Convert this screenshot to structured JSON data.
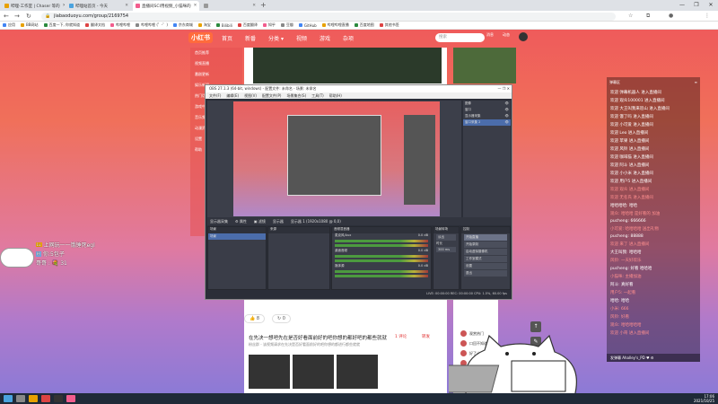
{
  "browser": {
    "tabs": [
      {
        "label": "哔哩-工作室 | Chaser 等的",
        "color": "#e8a100"
      },
      {
        "label": "哔哩站首页 - 今天",
        "color": "#4aa3df"
      },
      {
        "label": "直播间SCI用视频_小猫咪的",
        "color": "#f25d8e",
        "active": true
      },
      {
        "label": "",
        "color": "#999"
      }
    ],
    "new_tab": "+",
    "window_controls": [
      "—",
      "❐",
      "✕"
    ],
    "nav": {
      "back": "←",
      "forward": "→",
      "reload": "↻"
    },
    "url": "jiabaoduoyu.com/group/2169754",
    "lock": "🔒",
    "bookmarks": [
      "应用",
      "BB网站",
      "百度一下, 你就知道",
      "翻译文档",
      "哔哩哔哩",
      "哔哩哔哩 (゜-゜)",
      "京东商城",
      "淘宝",
      "Bilibili",
      "百度翻译",
      "知乎",
      "豆瓣",
      "GitHub",
      "哔哩哔哩直播",
      "百度地图",
      "其他书签"
    ]
  },
  "site": {
    "logo": "小红书",
    "nav": [
      "首页",
      "新番",
      "分类 ▾",
      "视频",
      "游戏",
      "杂项"
    ],
    "search_placeholder": "搜索",
    "top_icons": [
      "消息",
      "动态",
      "投稿"
    ],
    "left_menu": [
      "首页推荐",
      "视频直播",
      "番剧更新",
      "娱乐新闻",
      "热门话题",
      "游戏中心",
      "音乐频道",
      "动漫资讯",
      "设置",
      "帮助"
    ],
    "likes": "8",
    "shares": "0",
    "post_title": "在先决一想吧先在是否好看面前好的吧你想的都好吧的都些就就",
    "post_sub": "粉丝群 - 该视频请求在先决是否好看面前好的吧你想的都进行都些就就",
    "post_meta": [
      "1 评论",
      "转发"
    ],
    "right_cards": [
      "观赏热门",
      "口回不知道",
      "好了十阅读",
      "还差一大",
      "不加不知"
    ],
    "side_buttons": [
      "↑",
      "✎"
    ]
  },
  "danmaku": [
    {
      "text": "上网玩一一饿锤死egl",
      "badge": "Lv"
    },
    {
      "text": "你:5包子",
      "badge": "粉"
    },
    {
      "text": "哥哥 : 💐 31",
      "badge": ""
    }
  ],
  "chat": {
    "header_left": "弹幕区",
    "header_right": "≡",
    "messages": [
      {
        "text": "欢迎 弹幕机器人 进入直播间",
        "hl": false
      },
      {
        "text": "欢迎 观众100001 进入直播间",
        "hl": false
      },
      {
        "text": "欢迎 大王叫我来巡山 进入直播间",
        "hl": false
      },
      {
        "text": "欢迎 饿了吗 进入直播间",
        "hl": false
      },
      {
        "text": "欢迎 小可爱 进入直播间",
        "hl": false
      },
      {
        "text": "欢迎 Leo 进入直播间",
        "hl": false
      },
      {
        "text": "欢迎 苹果 进入直播间",
        "hl": false
      },
      {
        "text": "欢迎 风铃 进入直播间",
        "hl": false
      },
      {
        "text": "欢迎 咖啡猫 进入直播间",
        "hl": false
      },
      {
        "text": "欢迎 阿斗 进入直播间",
        "hl": false
      },
      {
        "text": "欢迎 小小米 进入直播间",
        "hl": false
      },
      {
        "text": "欢迎 用户5 进入直播间",
        "hl": false
      },
      {
        "text": "欢迎 观众 进入直播间",
        "hl": true
      },
      {
        "text": "欢迎 无名氏 进入直播间",
        "hl": true
      },
      {
        "text": "哈哈哈哈: 哈哈",
        "hl": false
      },
      {
        "text": "观众: 哈哈哈 是好看的 加油",
        "hl": true
      },
      {
        "text": "pucheng: 666666",
        "hl": false
      },
      {
        "text": "小可爱: 哈哈哈哈 送出礼物",
        "hl": true
      },
      {
        "text": "pucheng: 88888",
        "hl": false
      },
      {
        "text": "欢迎 来了 进入直播间",
        "hl": true
      },
      {
        "text": "大王叫我: 哈哈哈",
        "hl": false
      },
      {
        "text": "风铃: 一天好欢乐",
        "hl": true
      },
      {
        "text": "pucheng: 好看 哈哈哈",
        "hl": false
      },
      {
        "text": "小猫咪: 主播加油",
        "hl": true
      },
      {
        "text": "阿斗: 真好看",
        "hl": false
      },
      {
        "text": "用户5: 一起看",
        "hl": true
      },
      {
        "text": "哈哈: 哈哈",
        "hl": false
      },
      {
        "text": "小米: 666",
        "hl": true
      },
      {
        "text": "风铃: 好看",
        "hl": true
      },
      {
        "text": "观众: 哈哈哈哈哈",
        "hl": true
      },
      {
        "text": "欢迎 小哥 进入直播间",
        "hl": true
      }
    ],
    "footer": "发弹幕  Ahalley's_PD  ♥  ⚙"
  },
  "obs": {
    "title": "OBS 27.1.3 (64-bit, windows) - 配置文件: 未命名 - 场景: 未命名",
    "menu": [
      "文件(F)",
      "编辑(E)",
      "视图(V)",
      "配置文件(P)",
      "场景集合(S)",
      "工具(T)",
      "帮助(H)"
    ],
    "sources": [
      "图像",
      "窗口",
      "显示器采集",
      "窗口采集 2"
    ],
    "bar": [
      "显示器采集",
      "⚙ 属性",
      "▣ 滤镜",
      "显示器",
      "显示器 1 (1920x1080 @ 0,0)"
    ],
    "docks": {
      "scenes": "场景",
      "sources": "来源",
      "mixer": "音频混音器",
      "transitions": "场景转场",
      "controls": "控制"
    },
    "mixer_channels": [
      {
        "name": "麦克风/Aux",
        "db": "0.0 dB"
      },
      {
        "name": "桌面音频",
        "db": "0.0 dB"
      },
      {
        "name": "媒体源",
        "db": "0.0 dB"
      }
    ],
    "transition": {
      "type": "淡出",
      "duration_label": "时长",
      "duration": "300 ms"
    },
    "controls": [
      "开始直播",
      "开始录制",
      "启动虚拟摄像机",
      "工作室模式",
      "设置",
      "退出"
    ],
    "status": "LIVE: 00:00:00   REC: 00:00:00   CPU: 1.5%, 60.00 fps"
  },
  "taskbar": {
    "time": "17:06",
    "date": "2021/10/25"
  }
}
